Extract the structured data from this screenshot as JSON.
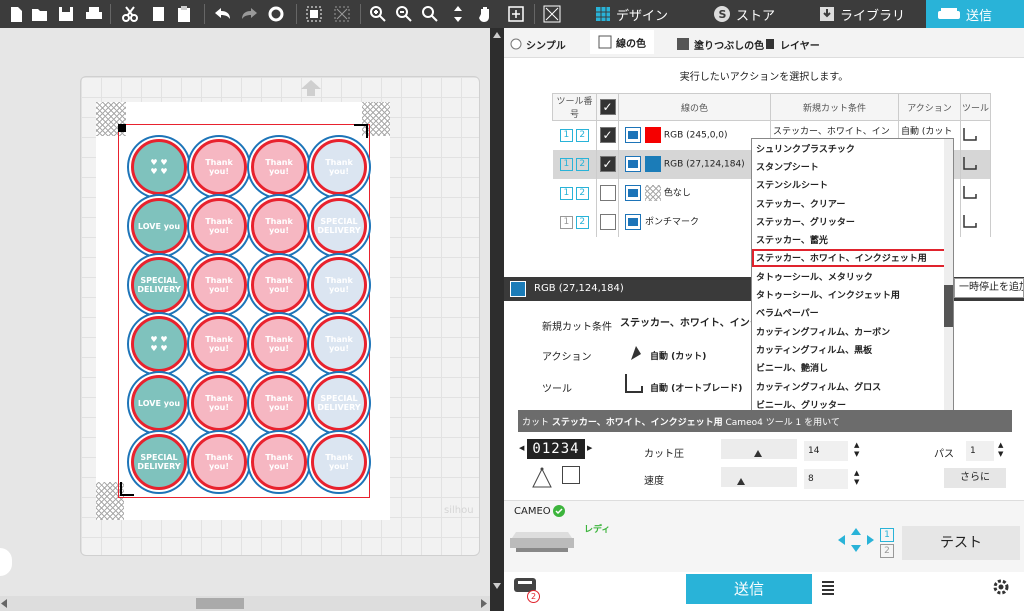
{
  "toolbar": {
    "icons": [
      "new-doc-icon",
      "open-folder-icon",
      "save-icon",
      "print-icon",
      "scissors-icon",
      "copy-icon",
      "paste-icon",
      "undo-icon",
      "redo-icon",
      "refresh-icon",
      "group-icon",
      "ungroup-icon",
      "zoom-in-icon",
      "zoom-out-icon",
      "zoom-fit-icon",
      "move-icon",
      "pan-hand-icon",
      "add-page-icon",
      "trace-icon"
    ]
  },
  "nav": {
    "design": "デザイン",
    "store": "ストア",
    "library": "ライブラリ",
    "send": "送信"
  },
  "subtabs": {
    "simple": "シンプル",
    "line": "線の色",
    "fill": "塗りつぶしの色",
    "layer": "レイヤー"
  },
  "prompt": "実行したいアクションを選択します。",
  "table": {
    "headers": [
      "ツール番号",
      "",
      "線の色",
      "新規カット条件",
      "アクション",
      "ツール"
    ],
    "rows": [
      {
        "tool1": "1",
        "tool2": "2",
        "checked": true,
        "color_label": "RGB (245,0,0)",
        "color": "#f50000",
        "condition": "ステッカー、ホワイト、イン▼",
        "action": "自動 (カット▼"
      },
      {
        "tool1": "1",
        "tool2": "2",
        "checked": true,
        "color_label": "RGB (27,124,184)",
        "color": "#1b7cb8",
        "condition": "",
        "action": ""
      },
      {
        "tool1": "1",
        "tool2": "2",
        "checked": false,
        "color_label": "色なし",
        "color": "none",
        "condition": "",
        "action": ""
      },
      {
        "tool1": "1",
        "tool2": "2",
        "checked": false,
        "color_label": "ポンチマーク",
        "color": "none",
        "condition": "",
        "action": ""
      }
    ]
  },
  "dropdown": {
    "items": [
      "シュリンクプラスチック",
      "スタンプシート",
      "ステンシルシート",
      "ステッカー、クリアー",
      "ステッカー、グリッター",
      "ステッカー、蓄光",
      "ステッカー、ホワイト、インクジェット用",
      "タトゥーシール、メタリック",
      "タトゥーシール、インクジェット用",
      "ベラムペーパー",
      "カッティングフィルム、カーボン",
      "カッティングフィルム、黒板",
      "ビニール、艶消し",
      "カッティングフィルム、グロス",
      "ビニール、グリッター"
    ],
    "highlighted_index": 6
  },
  "selected_color": {
    "label": "RGB (27,124,184)",
    "color": "#1b7cb8",
    "pause_label": "一時停止を追加"
  },
  "settings": {
    "cond_label": "新規カット条件",
    "cond_value": "ステッカー、ホワイト、インクジ",
    "action_label": "アクション",
    "action_value": "自動 (カット)",
    "tool_label": "ツール",
    "tool_value": "自動 (オートブレード)"
  },
  "cutbar": {
    "prefix": "カット",
    "material": "ステッカー、ホワイト、インクジェット用",
    "suffix": "Cameo4 ツール 1 を用いて"
  },
  "params": {
    "blade_digits": "01234",
    "pressure_label": "カット圧",
    "pressure_value": "14",
    "speed_label": "速度",
    "speed_value": "8",
    "pass_label": "パス",
    "pass_value": "1",
    "more_label": "さらに"
  },
  "device": {
    "name": "CAMEO",
    "status": "レディ",
    "test_label": "テスト",
    "slot1": "1",
    "slot2": "2"
  },
  "send": {
    "label": "送信",
    "badge": "2"
  },
  "canvas": {
    "watermark": "silhou",
    "circles": [
      [
        "teal-hearts",
        "pink-you",
        "pink-you",
        "blue-you"
      ],
      [
        "teal-love",
        "pink-you",
        "pink-you",
        "blue-special"
      ],
      [
        "teal-special",
        "pink-you",
        "pink-you",
        "blue-you"
      ],
      [
        "teal-hearts",
        "pink-you",
        "pink-you",
        "blue-you"
      ],
      [
        "teal-love",
        "pink-you",
        "pink-you",
        "blue-special"
      ],
      [
        "teal-special",
        "pink-you",
        "pink-you",
        "blue-you"
      ]
    ],
    "circle_text": {
      "teal-love": "LOVE you",
      "teal-special": "SPECIAL DELIVERY",
      "blue-special": "SPECIAL DELIVERY",
      "pink-you": "Thank you!",
      "blue-you": "Thank you!",
      "teal-hearts": ""
    },
    "colors": {
      "teal": "#7fc2bd",
      "pink": "#f6b7c2",
      "blue": "#dbe5f1",
      "red": "#e8222e",
      "line_blue": "#1d74b8"
    }
  }
}
